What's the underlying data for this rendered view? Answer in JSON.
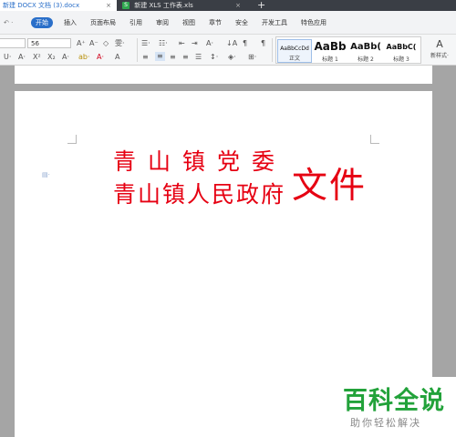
{
  "tabs": {
    "doc_tab": "新建 DOCX 文档 (3).docx",
    "xls_tab": "新建 XLS 工作表.xls",
    "xls_icon_letter": "S",
    "close_glyph": "×",
    "add_glyph": "+"
  },
  "menu": {
    "quick_access": "↶ ·",
    "items": [
      "开始",
      "插入",
      "页面布局",
      "引用",
      "审阅",
      "视图",
      "章节",
      "安全",
      "开发工具",
      "特色应用"
    ]
  },
  "ribbon": {
    "font_size": "56",
    "row1_icons": {
      "grow_font": "A⁺",
      "shrink_font": "A⁻",
      "clear_format": "◇",
      "phonetic": "雯·",
      "bullets": "☰·",
      "numbering": "☷·",
      "outdent": "⇤",
      "indent": "⇥",
      "char_scale": "A·",
      "sort": "↓A",
      "show_marks": "¶"
    },
    "row2_icons": {
      "underline": "U·",
      "strike": "A·",
      "superscript": "X²",
      "subscript": "X₂",
      "text_effect": "A·",
      "highlight": "ab·",
      "font_color": "A·",
      "char_border": "A",
      "align_left": "≡",
      "align_center": "≡",
      "align_right": "≡",
      "justify": "≡",
      "distribute": "☰",
      "line_spacing": "↕·",
      "shading": "◈·",
      "borders": "⊞·"
    },
    "styles": [
      {
        "preview": "AaBbCcDd",
        "name": "正文"
      },
      {
        "preview": "AaBb",
        "name": "标题 1"
      },
      {
        "preview": "AaBb(",
        "name": "标题 2"
      },
      {
        "preview": "AaBbC(",
        "name": "标题 3"
      }
    ],
    "new_style_icon": "A",
    "new_style_label": "新样式·"
  },
  "document": {
    "line1": "青山镇党委",
    "line2": "青山镇人民政府",
    "doc_word": "文件",
    "paragraph_icon": "▤·"
  },
  "watermark": {
    "title": "百科全说",
    "subtitle": "助你轻松解决"
  },
  "colors": {
    "red_header": "#e60012",
    "accent": "#2a6fc9",
    "watermark_green": "#22a23a"
  }
}
